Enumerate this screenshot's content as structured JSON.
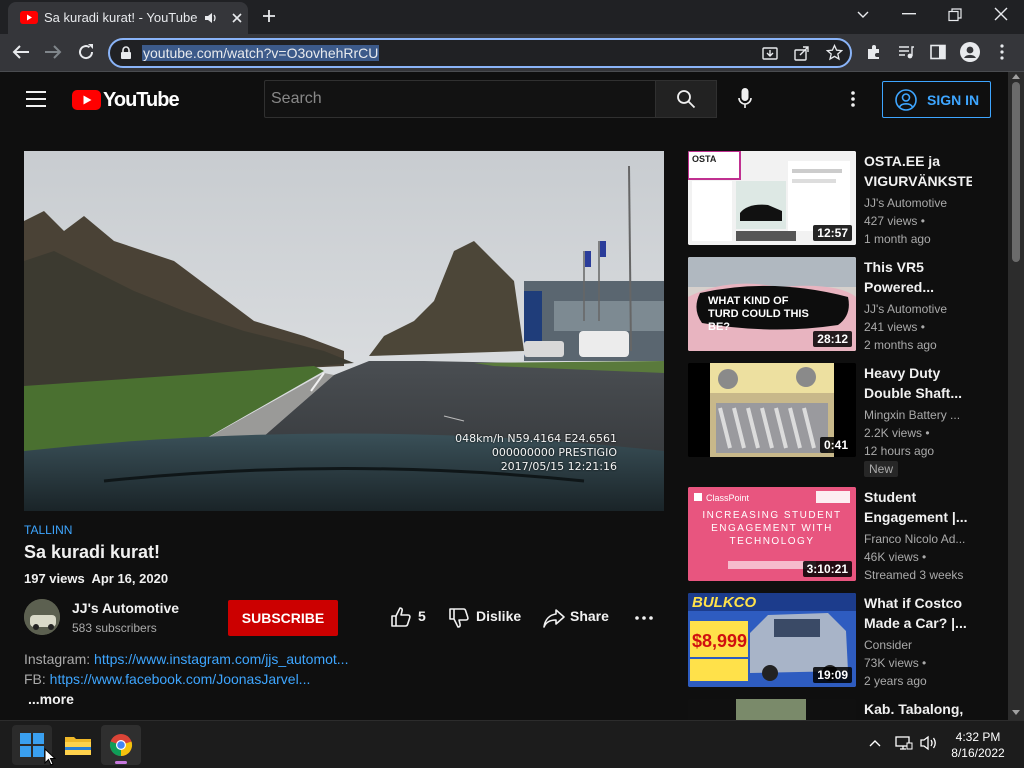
{
  "browser": {
    "tab_title": "Sa kuradi kurat! - YouTube",
    "url": "youtube.com/watch?v=O3ovhehRrCU"
  },
  "youtube": {
    "logo_text": "YouTube",
    "search_placeholder": "Search",
    "signin_label": "SIGN IN"
  },
  "video": {
    "osd": {
      "line1": "048km/h N59.4164 E24.6561",
      "line2": "000000000 PRESTIGIO",
      "line3": "2017/05/15 12:21:16"
    },
    "hashtag": "TALLINN",
    "title": "Sa kuradi kurat!",
    "meta": "197 views  Apr 16, 2020",
    "channel_name": "JJ's Automotive",
    "subscribers": "583 subscribers",
    "subscribe_label": "SUBSCRIBE",
    "likes": "5",
    "dislike_label": "Dislike",
    "share_label": "Share",
    "description": {
      "instagram_label": "Instagram: ",
      "instagram_link": "https://www.instagram.com/jjs_automot...",
      "fb_label": "FB: ",
      "fb_link": "https://www.facebook.com/JoonasJarvel...",
      "more_label": "...more"
    }
  },
  "recommendations": [
    {
      "title": "OSTA.EE ja VIGURVÄNKSTE",
      "channel": "JJ's Automotive",
      "views": "427 views •",
      "age": "1 month ago",
      "duration": "12:57"
    },
    {
      "title": "This VR5 Powered...",
      "channel": "JJ's Automotive",
      "views": "241 views •",
      "age": "2 months ago",
      "duration": "28:12",
      "thumb_text": "WHAT KIND OF TURD COULD THIS BE?"
    },
    {
      "title": "Heavy Duty Double Shaft...",
      "channel": "Mingxin Battery ...",
      "views": "2.2K views •",
      "age": "12 hours ago",
      "duration": "0:41",
      "badge": "New"
    },
    {
      "title": "Student Engagement |...",
      "channel": "Franco Nicolo Ad...",
      "views": "46K views •",
      "age": "Streamed 3 weeks",
      "duration": "3:10:21",
      "thumb_text": "INCREASING STUDENT ENGAGEMENT WITH TECHNOLOGY",
      "thumb_brand": "ClassPoint"
    },
    {
      "title": "What if Costco Made a Car? |...",
      "channel": "Consider",
      "views": "73K views •",
      "age": "2 years ago",
      "duration": "19:09",
      "thumb_text": "BULKCO",
      "thumb_price": "$8,999"
    },
    {
      "title": "Kab. Tabalong,"
    }
  ],
  "taskbar": {
    "time": "4:32 PM",
    "date": "8/16/2022"
  },
  "colors": {
    "accent_blue": "#3ea6ff",
    "subscribe_red": "#cc0000",
    "youtube_red": "#ff0000",
    "page_bg": "#0f0f0f"
  }
}
